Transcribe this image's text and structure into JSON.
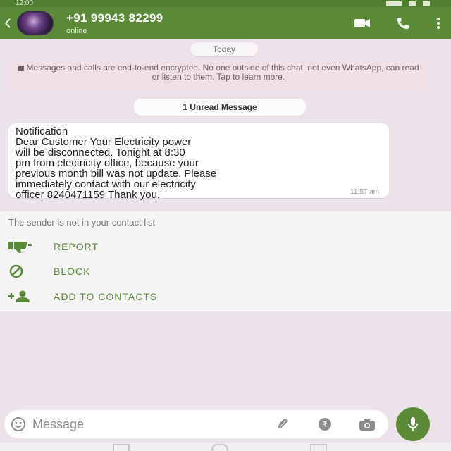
{
  "status_bar": {
    "time": "12:00"
  },
  "header": {
    "contact_name": "+91 99943 82299",
    "contact_status": "online",
    "icons": [
      "back-arrow-icon",
      "video-call-icon",
      "voice-call-icon",
      "more-options-icon"
    ]
  },
  "chat": {
    "date_label": "Today",
    "encryption_notice": "Messages and calls are end-to-end encrypted. No one outside of this chat, not even WhatsApp, can read or listen to them. Tap to learn more.",
    "unread_label": "1 Unread Message",
    "message": {
      "text": "Notification\nDear Customer Your Electricity power\nwill be disconnected. Tonight at 8:30\npm from electricity office, because your\nprevious month bill was not update. Please\nimmediately contact with our electricity\nofficer 8240471159 Thank you.",
      "time": "11:57 am"
    }
  },
  "unknown_sender": {
    "note": "The sender is not in your contact list",
    "actions": [
      {
        "label": "REPORT",
        "icon": "thumbs-down-icon"
      },
      {
        "label": "BLOCK",
        "icon": "block-icon"
      },
      {
        "label": "ADD TO CONTACTS",
        "icon": "add-contact-icon"
      }
    ]
  },
  "input": {
    "placeholder": "Message",
    "icons": [
      "emoji-icon",
      "attach-icon",
      "rupee-payment-icon",
      "camera-icon",
      "mic-icon"
    ]
  },
  "colors": {
    "header": "#5a8a37",
    "chat_background": "#ece3ea",
    "accent": "#5a8a37"
  }
}
